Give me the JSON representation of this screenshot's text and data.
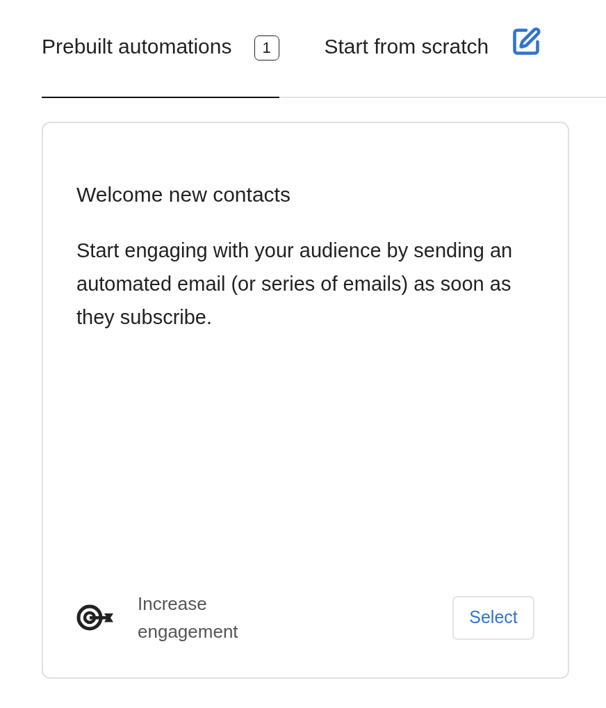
{
  "tabs": [
    {
      "label": "Prebuilt automations",
      "kind": "badge",
      "badge": "1",
      "selected": true
    },
    {
      "label": "Start from scratch",
      "kind": "icon",
      "selected": false
    }
  ],
  "card": {
    "title": "Welcome new contacts",
    "description": "Start engaging with your audience by sending an automated email (or series of emails) as soon as they subscribe.",
    "goal": "Increase engagement",
    "button": "Select"
  }
}
